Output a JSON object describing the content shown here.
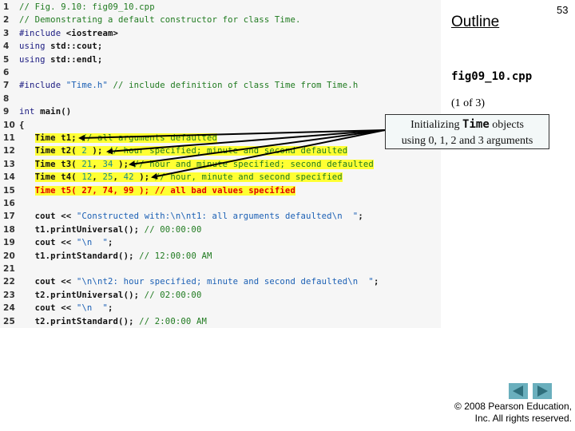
{
  "slide": {
    "title": "Outline",
    "page_number": "53",
    "file_name": "fig09_10.cpp",
    "part_label": "(1 of 3)"
  },
  "callout": {
    "text_before": "Initializing ",
    "text_code": "Time",
    "text_after": " objects",
    "line2": "using 0, 1, 2 and 3 arguments"
  },
  "code": {
    "lines": [
      {
        "n": "1",
        "parts": [
          {
            "t": "// Fig. 9.10: fig09_10.cpp",
            "c": "c-cm"
          }
        ]
      },
      {
        "n": "2",
        "parts": [
          {
            "t": "// Demonstrating a default constructor for class Time.",
            "c": "c-cm"
          }
        ]
      },
      {
        "n": "3",
        "parts": [
          {
            "t": "#include ",
            "c": "c-kw"
          },
          {
            "t": "<iostream>",
            "c": "c-tx"
          }
        ]
      },
      {
        "n": "4",
        "parts": [
          {
            "t": "using ",
            "c": "c-kw"
          },
          {
            "t": "std::cout;",
            "c": "c-tx"
          }
        ]
      },
      {
        "n": "5",
        "parts": [
          {
            "t": "using ",
            "c": "c-kw"
          },
          {
            "t": "std::endl;",
            "c": "c-tx"
          }
        ]
      },
      {
        "n": "6",
        "parts": []
      },
      {
        "n": "7",
        "parts": [
          {
            "t": "#include ",
            "c": "c-kw"
          },
          {
            "t": "\"Time.h\"",
            "c": "c-str"
          },
          {
            "t": " // include definition of class Time from Time.h",
            "c": "c-cm"
          }
        ]
      },
      {
        "n": "8",
        "parts": []
      },
      {
        "n": "9",
        "parts": [
          {
            "t": "int ",
            "c": "c-kw"
          },
          {
            "t": "main()",
            "c": "c-tx"
          }
        ]
      },
      {
        "n": "10",
        "parts": [
          {
            "t": "{",
            "c": "c-tx"
          }
        ]
      },
      {
        "n": "11",
        "hl": true,
        "parts": [
          {
            "t": "   "
          },
          {
            "t": "Time t1;",
            "c": "c-tx hl"
          },
          {
            "t": " // all arguments defaulted",
            "c": "c-cm hl"
          }
        ]
      },
      {
        "n": "12",
        "hl": true,
        "parts": [
          {
            "t": "   "
          },
          {
            "t": "Time t2( ",
            "c": "c-tx hl"
          },
          {
            "t": "2",
            "c": "c-num hl"
          },
          {
            "t": " );",
            "c": "c-tx hl"
          },
          {
            "t": " // hour specified; minute and second defaulted",
            "c": "c-cm hl"
          }
        ]
      },
      {
        "n": "13",
        "hl": true,
        "parts": [
          {
            "t": "   "
          },
          {
            "t": "Time t3( ",
            "c": "c-tx hl"
          },
          {
            "t": "21",
            "c": "c-num hl"
          },
          {
            "t": ", ",
            "c": "c-tx hl"
          },
          {
            "t": "34",
            "c": "c-num hl"
          },
          {
            "t": " );",
            "c": "c-tx hl"
          },
          {
            "t": " // hour and minute specified; second defaulted",
            "c": "c-cm hl"
          }
        ]
      },
      {
        "n": "14",
        "hl": true,
        "parts": [
          {
            "t": "   "
          },
          {
            "t": "Time t4( ",
            "c": "c-tx hl"
          },
          {
            "t": "12",
            "c": "c-num hl"
          },
          {
            "t": ", ",
            "c": "c-tx hl"
          },
          {
            "t": "25",
            "c": "c-num hl"
          },
          {
            "t": ", ",
            "c": "c-tx hl"
          },
          {
            "t": "42",
            "c": "c-num hl"
          },
          {
            "t": " );",
            "c": "c-tx hl"
          },
          {
            "t": " // hour, minute and second specified",
            "c": "c-cm hl"
          }
        ]
      },
      {
        "n": "15",
        "hl": true,
        "parts": [
          {
            "t": "   "
          },
          {
            "t": "Time t5( 27, 74, 99 ); // all bad values specified",
            "c": "c-red hl"
          }
        ]
      },
      {
        "n": "16",
        "parts": []
      },
      {
        "n": "17",
        "parts": [
          {
            "t": "   "
          },
          {
            "t": "cout << ",
            "c": "c-tx"
          },
          {
            "t": "\"Constructed with:\\n\\nt1: all arguments defaulted\\n  \"",
            "c": "c-str"
          },
          {
            "t": ";",
            "c": "c-tx"
          }
        ]
      },
      {
        "n": "18",
        "parts": [
          {
            "t": "   "
          },
          {
            "t": "t1.printUniversal();",
            "c": "c-tx"
          },
          {
            "t": " // 00:00:00",
            "c": "c-cm"
          }
        ]
      },
      {
        "n": "19",
        "parts": [
          {
            "t": "   "
          },
          {
            "t": "cout << ",
            "c": "c-tx"
          },
          {
            "t": "\"\\n  \"",
            "c": "c-str"
          },
          {
            "t": ";",
            "c": "c-tx"
          }
        ]
      },
      {
        "n": "20",
        "parts": [
          {
            "t": "   "
          },
          {
            "t": "t1.printStandard();",
            "c": "c-tx"
          },
          {
            "t": " // 12:00:00 AM",
            "c": "c-cm"
          }
        ]
      },
      {
        "n": "21",
        "parts": []
      },
      {
        "n": "22",
        "parts": [
          {
            "t": "   "
          },
          {
            "t": "cout << ",
            "c": "c-tx"
          },
          {
            "t": "\"\\n\\nt2: hour specified; minute and second defaulted\\n  \"",
            "c": "c-str"
          },
          {
            "t": ";",
            "c": "c-tx"
          }
        ]
      },
      {
        "n": "23",
        "parts": [
          {
            "t": "   "
          },
          {
            "t": "t2.printUniversal();",
            "c": "c-tx"
          },
          {
            "t": " // 02:00:00",
            "c": "c-cm"
          }
        ]
      },
      {
        "n": "24",
        "parts": [
          {
            "t": "   "
          },
          {
            "t": "cout << ",
            "c": "c-tx"
          },
          {
            "t": "\"\\n  \"",
            "c": "c-str"
          },
          {
            "t": ";",
            "c": "c-tx"
          }
        ]
      },
      {
        "n": "25",
        "parts": [
          {
            "t": "   "
          },
          {
            "t": "t2.printStandard();",
            "c": "c-tx"
          },
          {
            "t": " // 2:00:00 AM",
            "c": "c-cm"
          }
        ]
      }
    ]
  },
  "navigation": {
    "prev_icon": "triangle-left-icon",
    "next_icon": "triangle-right-icon",
    "button_color": "#6aafbd"
  },
  "footer": {
    "copyright_line1": "© 2008 Pearson Education,",
    "copyright_line2": "Inc.  All rights reserved."
  }
}
